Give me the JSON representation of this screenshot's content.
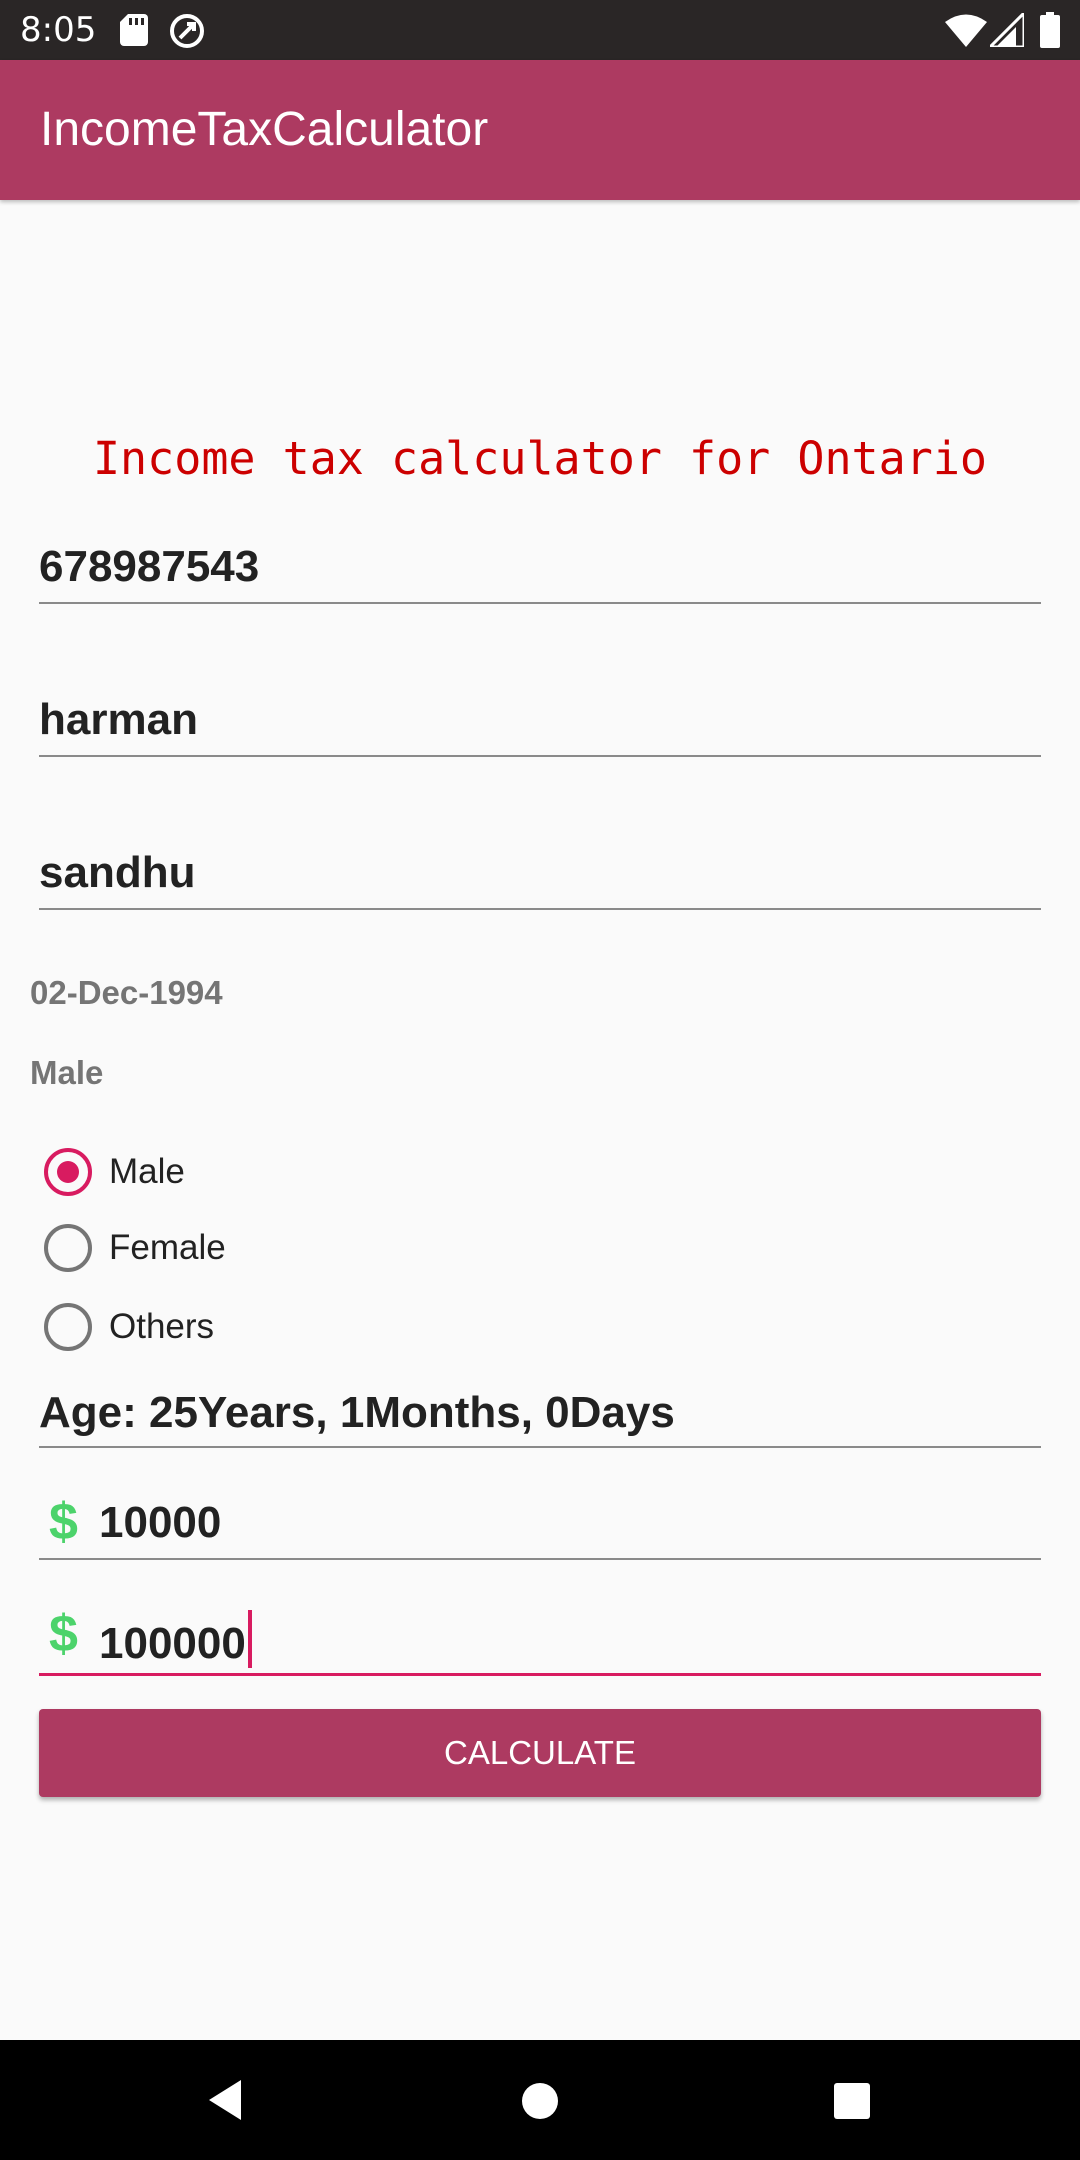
{
  "status_bar": {
    "time": "8:05",
    "icons": [
      "sd-card-icon",
      "sync-icon",
      "wifi-icon",
      "signal-icon",
      "battery-icon"
    ]
  },
  "app_bar": {
    "title": "IncomeTaxCalculator",
    "color": "#ad3a61"
  },
  "form": {
    "heading": "Income tax calculator for Ontario",
    "sin_value": "678987543",
    "first_name_value": "harman",
    "last_name_value": "sandhu",
    "dob_text": "02-Dec-1994",
    "gender_text": "Male",
    "gender_options": [
      {
        "label": "Male",
        "selected": true
      },
      {
        "label": "Female",
        "selected": false
      },
      {
        "label": "Others",
        "selected": false
      }
    ],
    "age_value": "Age: 25Years, 1Months, 0Days",
    "currency_symbol": "$",
    "rrsp_value": "10000",
    "income_value": "100000",
    "calculate_label": "CALCULATE"
  },
  "colors": {
    "accent": "#d81b60",
    "heading": "#cc0000",
    "currency": "#4cd36b"
  }
}
